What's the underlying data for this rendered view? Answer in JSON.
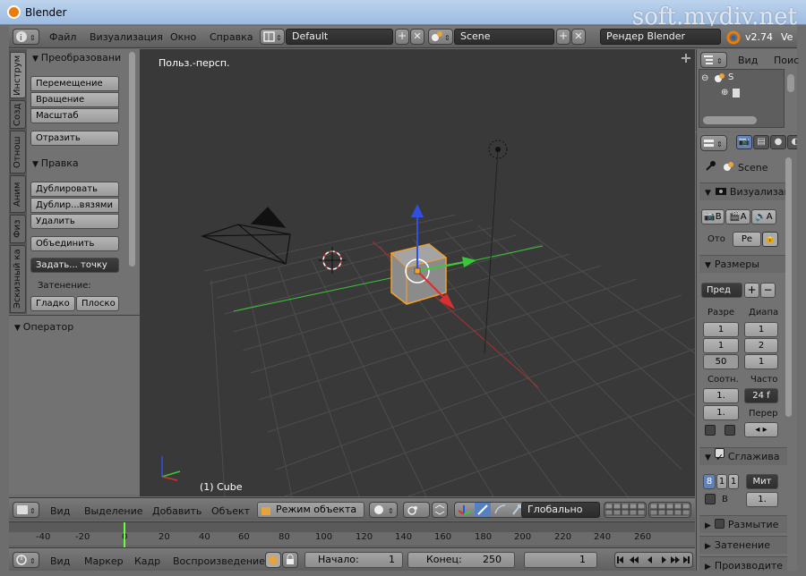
{
  "window": {
    "title": "Blender",
    "watermark": "soft.mydiv.net"
  },
  "menu": {
    "file": "Файл",
    "view": "Визуализация",
    "window": "Окно",
    "help": "Справка"
  },
  "header": {
    "layout": "Default",
    "scene": "Scene",
    "engine": "Рендер Blender",
    "version": "v2.74",
    "version_extra": "Ve"
  },
  "tabs": [
    "Инструм",
    "Созд",
    "Отнош",
    "Аним",
    "Физ",
    "Эскизный ка"
  ],
  "toolshelf": {
    "transform_title": "Преобразовани",
    "move": "Перемещение",
    "rotate": "Вращение",
    "scale": "Масштаб",
    "mirror": "Отразить",
    "edit_title": "Правка",
    "duplicate": "Дублировать",
    "duplicate_linked": "Дублир...вязями",
    "delete": "Удалить",
    "join": "Объединить",
    "set_origin": "Задать... точку",
    "shading_label": "Затенение:",
    "smooth": "Гладко",
    "flat": "Плоско",
    "operator_title": "Оператор"
  },
  "viewport": {
    "view_name": "Польз.-персп.",
    "object_name": "(1) Cube"
  },
  "viewport_header": {
    "view": "Вид",
    "select": "Выделение",
    "add": "Добавить",
    "object": "Объект",
    "mode": "Режим объекта",
    "orientation": "Глобально"
  },
  "timeline": {
    "ticks": [
      "-40",
      "-20",
      "0",
      "20",
      "40",
      "60",
      "80",
      "100",
      "120",
      "140",
      "160",
      "180",
      "200",
      "220",
      "240",
      "260"
    ],
    "view": "Вид",
    "marker": "Маркер",
    "frame": "Кадр",
    "playback": "Воспроизведение",
    "start_label": "Начало:",
    "start_value": "1",
    "end_label": "Конец:",
    "end_value": "250",
    "current": "1"
  },
  "outliner": {
    "view": "Вид",
    "search": "Поис",
    "row1": "S"
  },
  "properties": {
    "scene": "Scene",
    "render_title": "Визуализаци",
    "render_btn1": "В",
    "render_btn2": "А",
    "render_btn3": "А",
    "display_label": "Ото",
    "display_value": "Ре",
    "dimensions_title": "Размеры",
    "preset": "Пред",
    "resolution_label": "Разре",
    "range_label": "Диапа",
    "res_x": "1",
    "res_y": "1",
    "res_pct": "50",
    "frame_start": "1",
    "frame_end": "2",
    "frame_step": "1",
    "aspect_label": "Соотн.",
    "rate_label": "Часто",
    "aspect_x": "1.",
    "aspect_y": "1.",
    "fps": "24 f",
    "remap_label": "Перер",
    "aa_title": "Сглажива",
    "aa_samples": [
      "8",
      "1",
      "1"
    ],
    "aa_filter": "Мит",
    "aa_check_label": "В",
    "aa_size": "1.",
    "motion_blur": "Размытие",
    "shading": "Затенение",
    "performance": "Производите"
  },
  "colors": {
    "accent_green": "#6aff3a",
    "selection_orange": "#f4a02a",
    "axis_red": "#d63030",
    "axis_green": "#3ac83a",
    "axis_blue": "#3050e0"
  }
}
